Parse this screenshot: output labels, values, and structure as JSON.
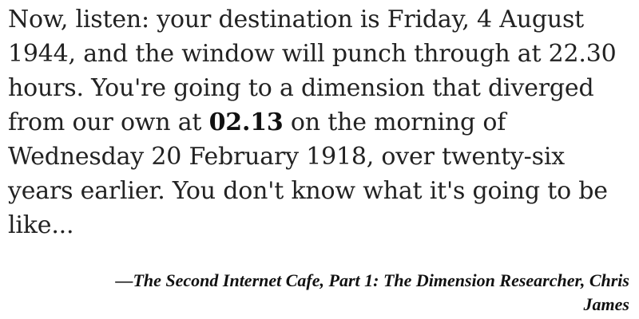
{
  "quote": {
    "before": "Now, listen: your destination is Friday, 4 August 1944, and the window will punch through at 22.30 hours. You're going to a dimension that diverged from our own at ",
    "emphasis": "02.13",
    "after": " on the morning of Wednesday 20 February 1918, over twenty-six years earlier. You don't know what it's going to be like..."
  },
  "attribution": {
    "text": "—The Second Internet Cafe, Part 1: The Dimension Researcher, Chris James"
  }
}
